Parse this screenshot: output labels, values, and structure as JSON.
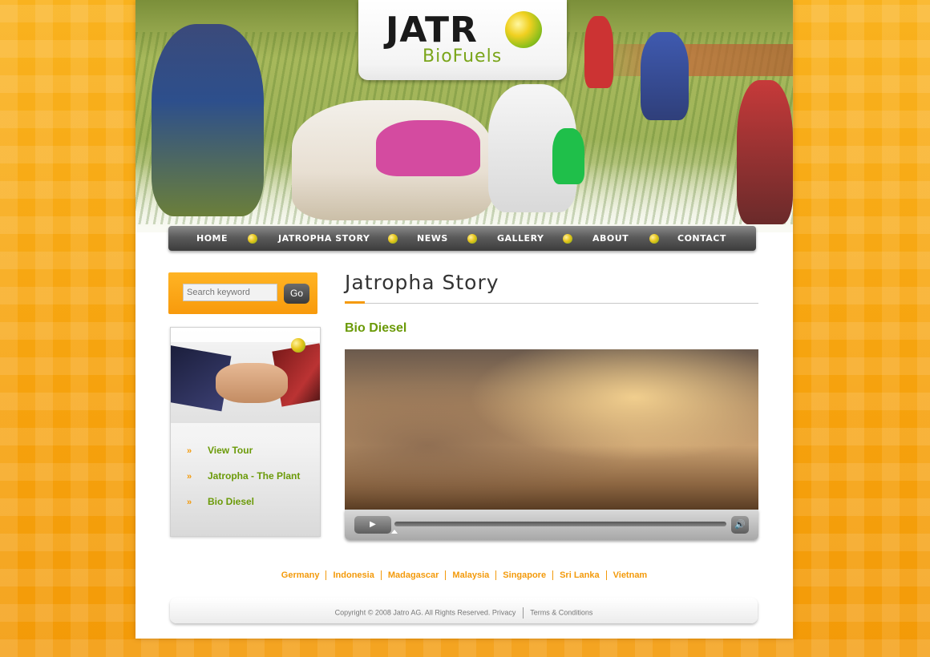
{
  "brand": {
    "name": "JATR",
    "sub": "BioFuels"
  },
  "nav": [
    {
      "label": "Home"
    },
    {
      "label": "Jatropha Story"
    },
    {
      "label": "News"
    },
    {
      "label": "Gallery"
    },
    {
      "label": "About"
    },
    {
      "label": "Contact"
    }
  ],
  "search": {
    "placeholder": "Search keyword",
    "button": "Go"
  },
  "sidebar": {
    "links": [
      {
        "label": "View Tour"
      },
      {
        "label": "Jatropha - The Plant"
      },
      {
        "label": "Bio Diesel"
      }
    ]
  },
  "main": {
    "title": "Jatropha Story",
    "section_heading": "Bio Diesel"
  },
  "countries": [
    "Germany",
    "Indonesia",
    "Madagascar",
    "Malaysia",
    "Singapore",
    "Sri Lanka",
    "Vietnam"
  ],
  "footer": {
    "copyright": "Copyright © 2008 Jatro AG. All Rights Reserved.",
    "privacy": "Privacy",
    "terms": "Terms & Conditions"
  },
  "colors": {
    "accent_orange": "#f39a0b",
    "accent_green": "#6b9a08"
  }
}
